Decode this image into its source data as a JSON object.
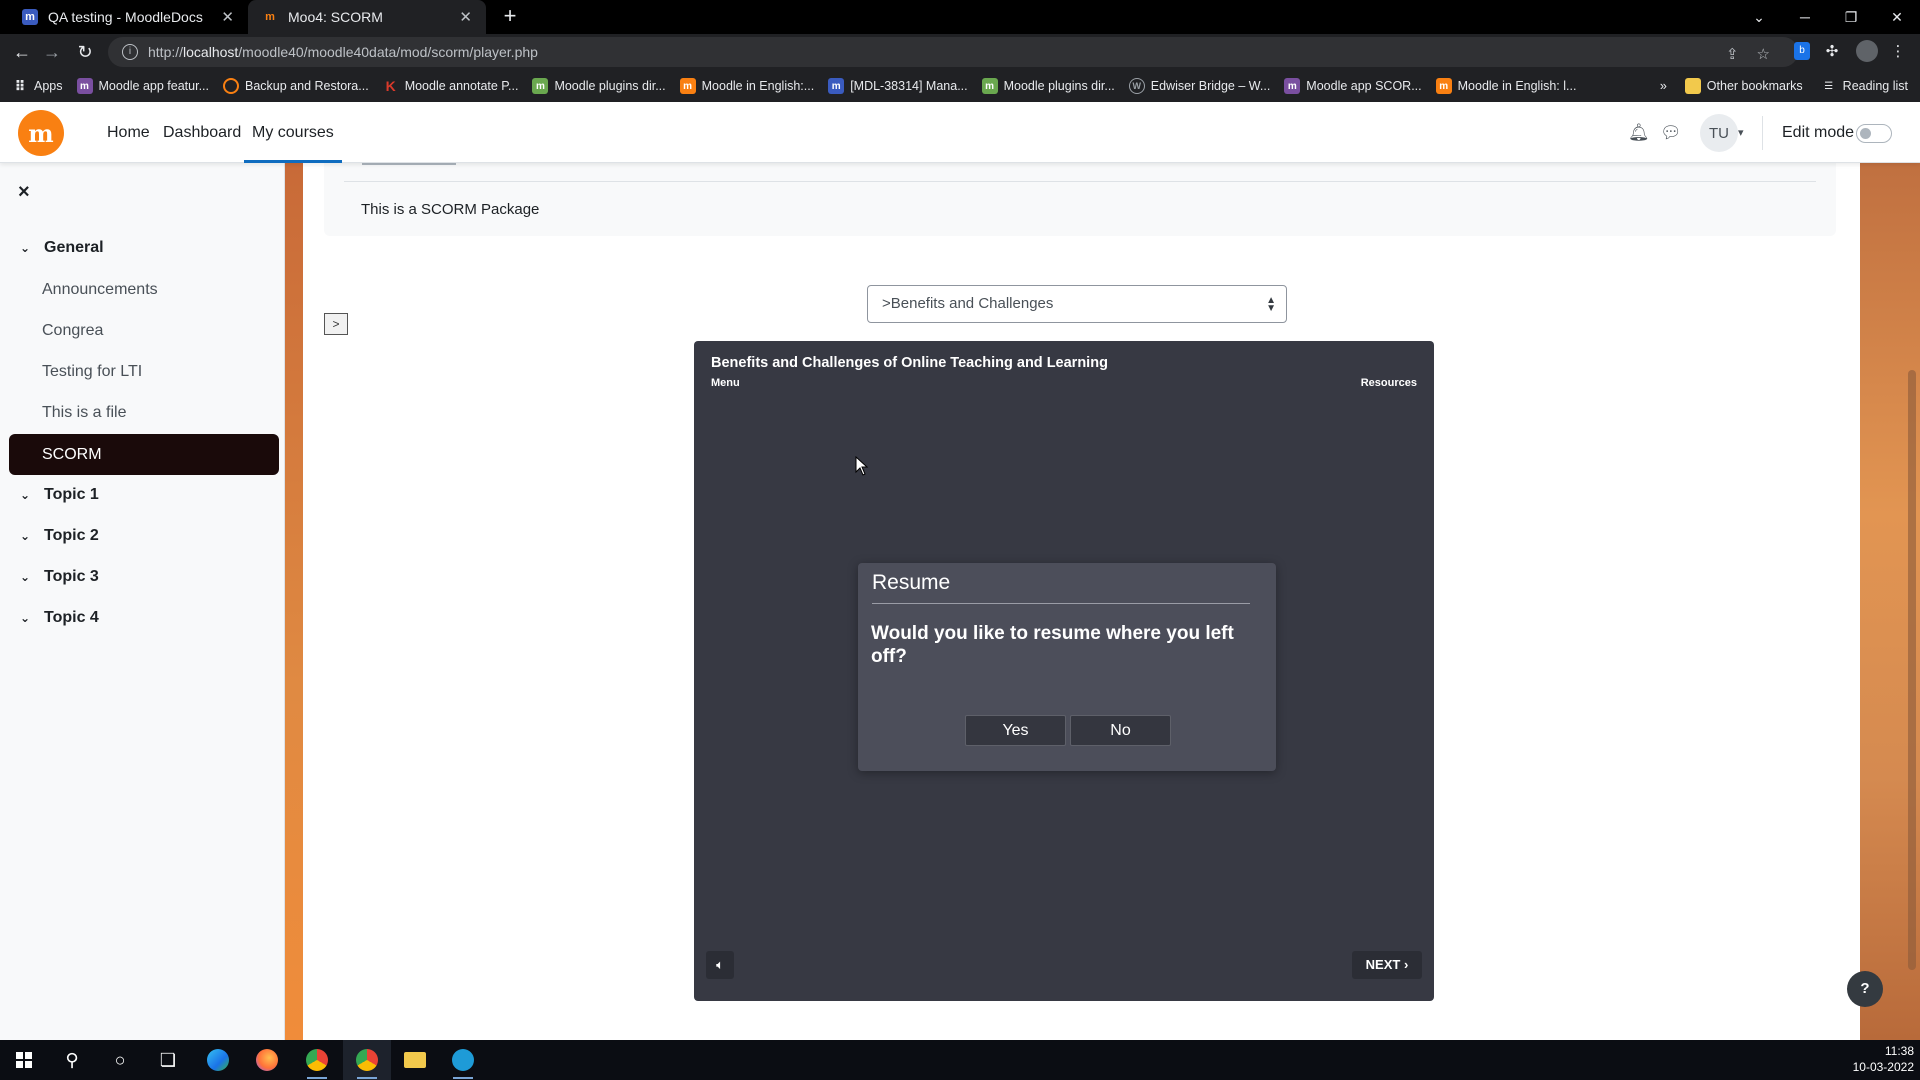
{
  "browser": {
    "tabs": [
      {
        "title": "QA testing - MoodleDocs",
        "active": false
      },
      {
        "title": "Moo4: SCORM",
        "active": true
      }
    ],
    "url_prefix": "http://",
    "url_host": "localhost",
    "url_path": "/moodle40/moodle40data/mod/scorm/player.php",
    "bookmarks": [
      {
        "label": "Apps",
        "icon": "apps-grid-icon",
        "color": "#e8eaed"
      },
      {
        "label": "Moodle app featur...",
        "icon": "moodle-icon",
        "color": "#7a4fa0"
      },
      {
        "label": "Backup and Restora...",
        "icon": "orange-circle-icon",
        "color": "#f98012"
      },
      {
        "label": "Moodle annotate P...",
        "icon": "k-icon",
        "color": "#d93a2b"
      },
      {
        "label": "Moodle plugins dir...",
        "icon": "moodle-green-icon",
        "color": "#6aa84f"
      },
      {
        "label": "Moodle in English:...",
        "icon": "moodle-orange-icon",
        "color": "#f98012"
      },
      {
        "label": "[MDL-38314] Mana...",
        "icon": "moodle-icon",
        "color": "#3a5bbf"
      },
      {
        "label": "Moodle plugins dir...",
        "icon": "moodle-green-icon",
        "color": "#6aa84f"
      },
      {
        "label": "Edwiser Bridge – W...",
        "icon": "wordpress-icon",
        "color": "#9aa0a6"
      },
      {
        "label": "Moodle app SCOR...",
        "icon": "moodle-icon",
        "color": "#7a4fa0"
      },
      {
        "label": "Moodle in English: l...",
        "icon": "moodle-orange-icon",
        "color": "#f98012"
      }
    ],
    "more_bookmarks": "»",
    "other_bookmarks": "Other bookmarks",
    "reading_list": "Reading list"
  },
  "navbar": {
    "links": [
      "Home",
      "Dashboard",
      "My courses"
    ],
    "active_link": "My courses",
    "avatar_initials": "TU",
    "edit_mode_label": "Edit mode"
  },
  "drawer": {
    "close": "×",
    "sections": [
      {
        "label": "General",
        "items": [
          "Announcements",
          "Congrea",
          "Testing for LTI",
          "This is a file",
          "SCORM"
        ]
      },
      {
        "label": "Topic 1",
        "items": []
      },
      {
        "label": "Topic 2",
        "items": []
      },
      {
        "label": "Topic 3",
        "items": []
      },
      {
        "label": "Topic 4",
        "items": []
      }
    ],
    "active_item": "SCORM"
  },
  "main": {
    "description": "This is a SCORM Package",
    "toc_selected": ">Benefits and Challenges",
    "toc_toggle": ">"
  },
  "player": {
    "title": "Benefits and Challenges of Online Teaching and Learning",
    "menu": "Menu",
    "resources": "Resources",
    "next": "NEXT",
    "dialog": {
      "title": "Resume",
      "message": "Would you like to resume where you left off?",
      "yes": "Yes",
      "no": "No"
    }
  },
  "help": "?",
  "taskbar": {
    "time": "11:38",
    "date": "10-03-2022"
  },
  "colors": {
    "moodle_orange": "#f98012",
    "player_bg": "#373943",
    "dialog_bg": "#4c4e5a",
    "active_nav": "#0f6cbf"
  }
}
